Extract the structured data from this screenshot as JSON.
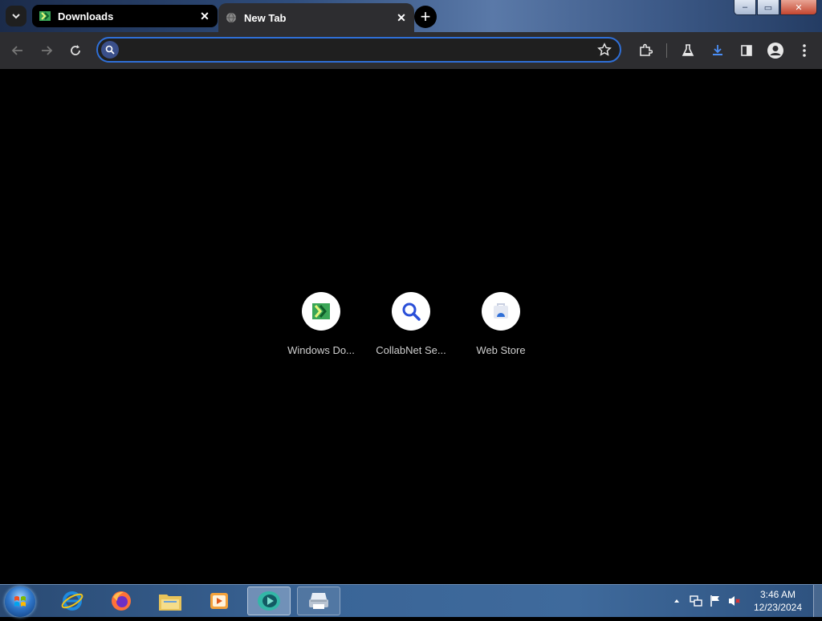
{
  "browser": {
    "tabs": [
      {
        "label": "Downloads",
        "favicon": "windows-downloads-icon",
        "state": "inactive"
      },
      {
        "label": "New Tab",
        "favicon": "globe-icon",
        "state": "active"
      }
    ],
    "close_glyph": "✕",
    "new_tab_glyph": "+",
    "omnibox": {
      "placeholder": "",
      "value": ""
    }
  },
  "window_controls": {
    "minimize": "–",
    "maximize": "▭",
    "close": "✕"
  },
  "shortcuts": [
    {
      "label": "Windows Do...",
      "icon": "windows-downloads-icon"
    },
    {
      "label": "CollabNet Se...",
      "icon": "search-icon"
    },
    {
      "label": "Web Store",
      "icon": "web-store-icon"
    }
  ],
  "taskbar": {
    "pinned": [
      "internet-explorer-icon",
      "firefox-icon",
      "file-explorer-icon",
      "media-player-icon",
      "chrome-app-icon",
      "printer-app-icon"
    ],
    "clock": {
      "time": "3:46 AM",
      "date": "12/23/2024"
    }
  },
  "colors": {
    "accent": "#2f6fd7",
    "tab_active_bg": "#2d2d30",
    "content_bg": "#000000"
  }
}
